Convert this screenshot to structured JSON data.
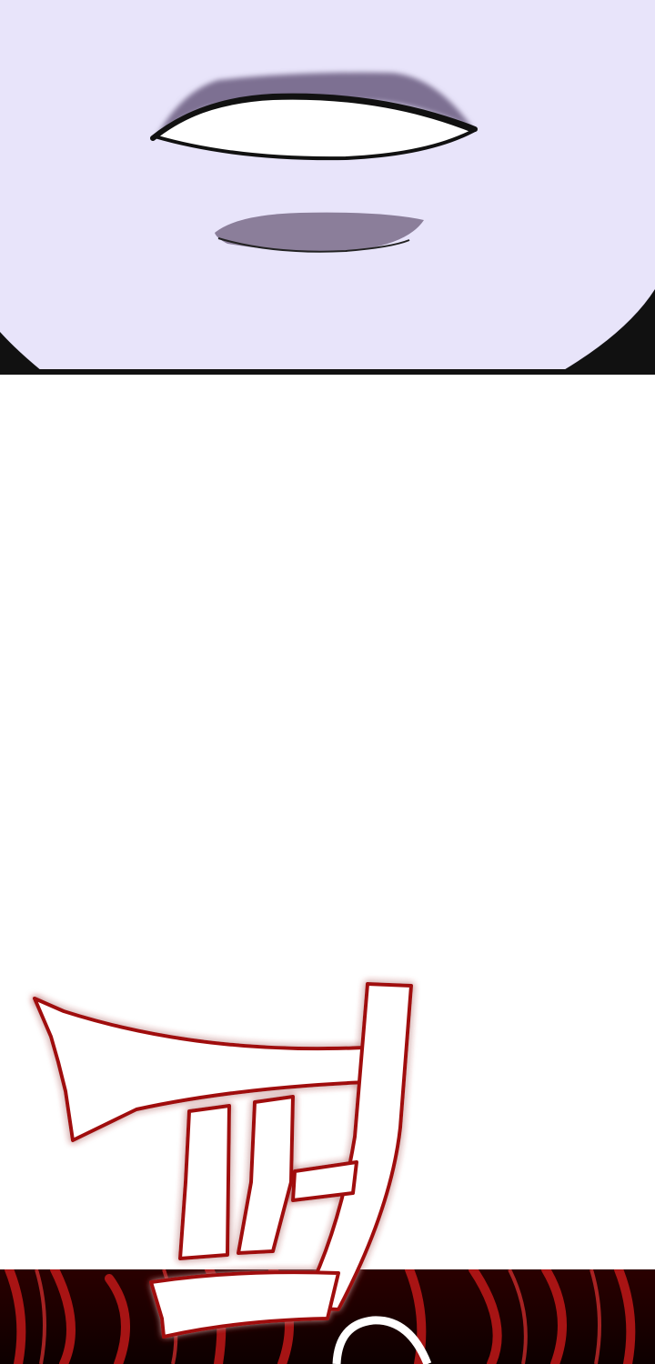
{
  "comic": {
    "panels": [
      {
        "id": "face-closeup",
        "description_name": "purple-face-panel"
      },
      {
        "id": "blank-gutter",
        "description_name": "white-space-panel"
      },
      {
        "id": "red-burst",
        "description_name": "red-energy-panel"
      }
    ],
    "sound_effect": {
      "text": "",
      "style": "white-fill-red-outline"
    }
  },
  "colors": {
    "skin": "#e8e4fa",
    "skin_shadow": "#8b7e9a",
    "outline": "#111111",
    "eye_white": "#ffffff",
    "background": "#ffffff",
    "burst_dark": "#1a0000",
    "burst_red": "#c01818",
    "sfx_stroke": "#a01010",
    "sfx_glow": "#ff4040",
    "sfx_fill": "#ffffff"
  }
}
